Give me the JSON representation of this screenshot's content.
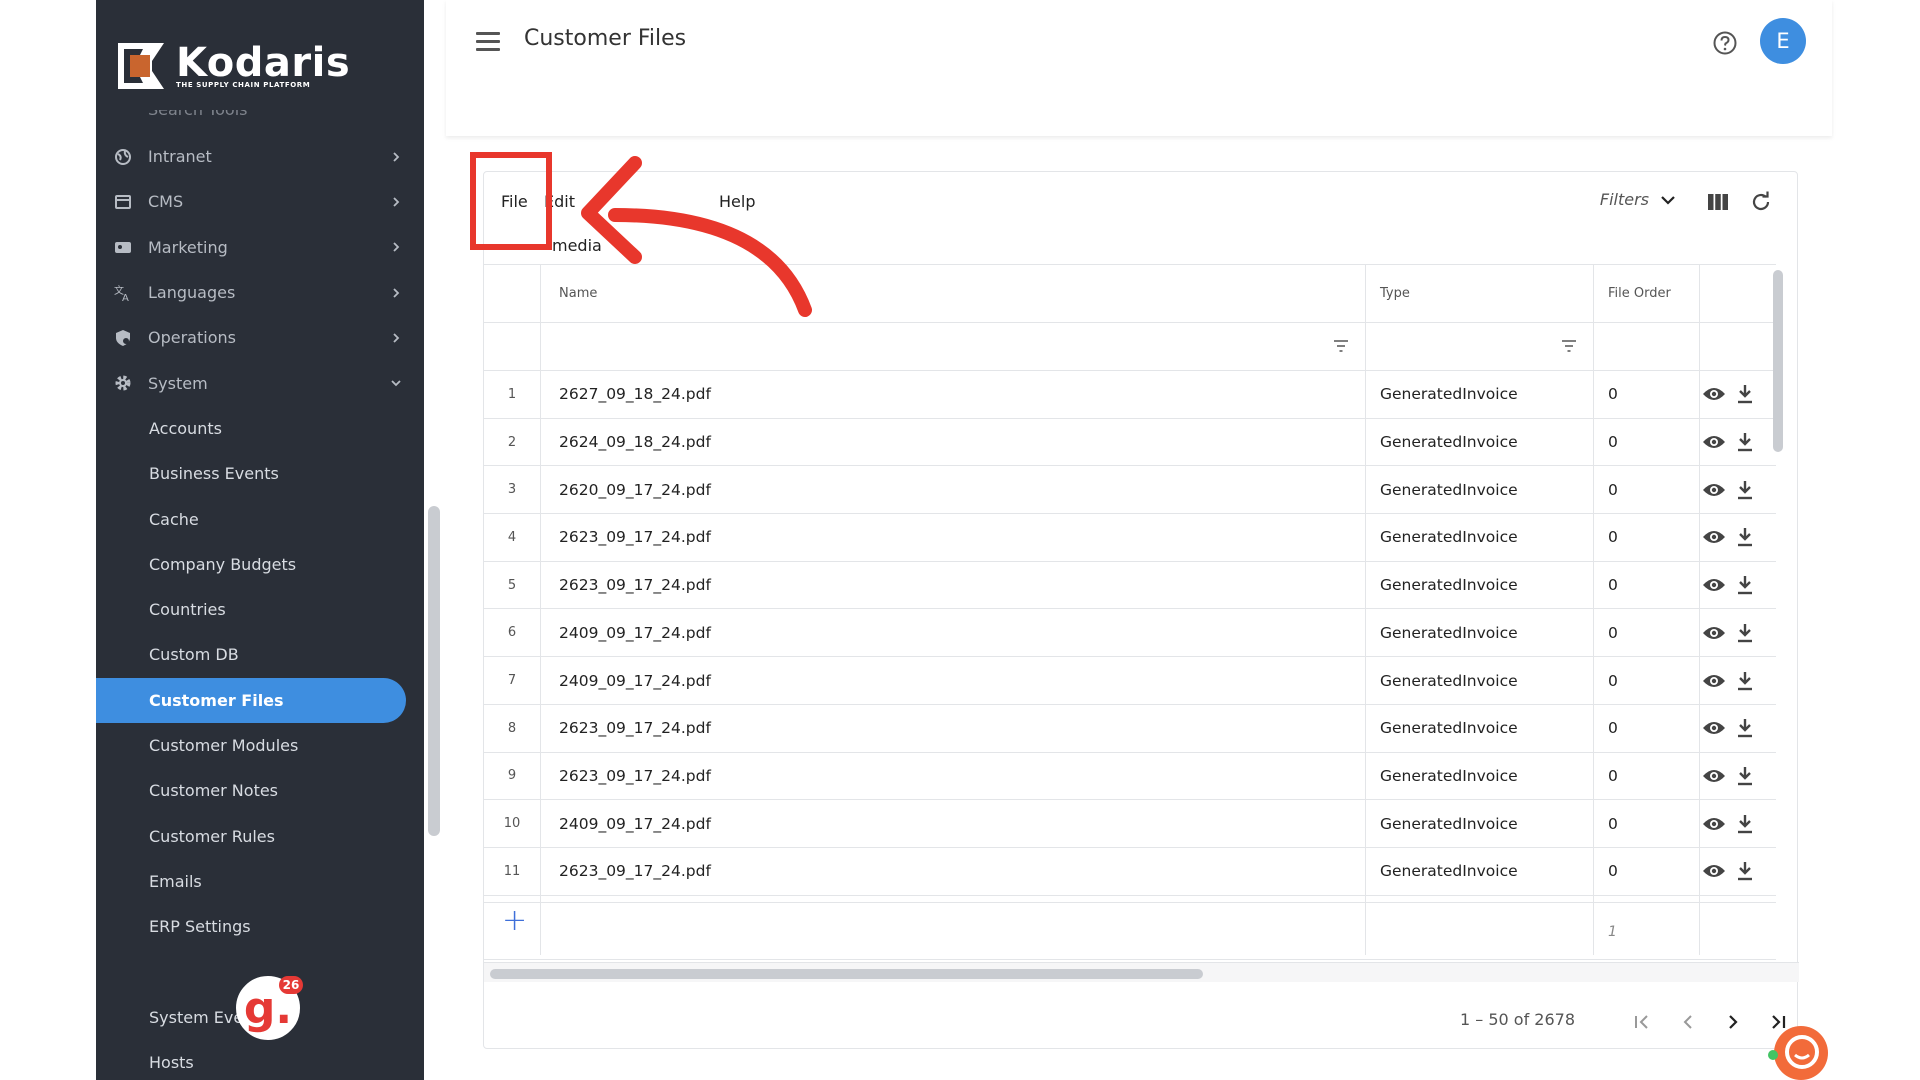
{
  "brand": {
    "name": "Kodaris",
    "tagline": "THE SUPPLY CHAIN PLATFORM"
  },
  "sidebar": {
    "partial_item": "Search Tools",
    "items": [
      {
        "label": "Intranet",
        "icon": "globe-icon"
      },
      {
        "label": "CMS",
        "icon": "cms-icon"
      },
      {
        "label": "Marketing",
        "icon": "marketing-icon"
      },
      {
        "label": "Languages",
        "icon": "translate-icon"
      },
      {
        "label": "Operations",
        "icon": "operations-icon"
      },
      {
        "label": "System",
        "icon": "gear-icon"
      }
    ],
    "system_items": [
      "Accounts",
      "Business Events",
      "Cache",
      "Company Budgets",
      "Countries",
      "Custom DB",
      "Customer Files",
      "Customer Modules",
      "Customer Notes",
      "Customer Rules",
      "Emails",
      "ERP Settings",
      "",
      "System Events",
      "Hosts"
    ],
    "active_item": "Customer Files",
    "badge_count": "26"
  },
  "header": {
    "title": "Customer Files",
    "avatar_letter": "E"
  },
  "toolbar": {
    "menu": [
      "File",
      "Edit",
      "",
      "Help"
    ],
    "filters_label": "Filters",
    "folder_path": "media"
  },
  "grid": {
    "columns": [
      "Name",
      "Type",
      "File Order"
    ],
    "rows": [
      {
        "num": "1",
        "name": "2627_09_18_24.pdf",
        "type": "GeneratedInvoice",
        "order": "0"
      },
      {
        "num": "2",
        "name": "2624_09_18_24.pdf",
        "type": "GeneratedInvoice",
        "order": "0"
      },
      {
        "num": "3",
        "name": "2620_09_17_24.pdf",
        "type": "GeneratedInvoice",
        "order": "0"
      },
      {
        "num": "4",
        "name": "2623_09_17_24.pdf",
        "type": "GeneratedInvoice",
        "order": "0"
      },
      {
        "num": "5",
        "name": "2623_09_17_24.pdf",
        "type": "GeneratedInvoice",
        "order": "0"
      },
      {
        "num": "6",
        "name": "2409_09_17_24.pdf",
        "type": "GeneratedInvoice",
        "order": "0"
      },
      {
        "num": "7",
        "name": "2409_09_17_24.pdf",
        "type": "GeneratedInvoice",
        "order": "0"
      },
      {
        "num": "8",
        "name": "2623_09_17_24.pdf",
        "type": "GeneratedInvoice",
        "order": "0"
      },
      {
        "num": "9",
        "name": "2623_09_17_24.pdf",
        "type": "GeneratedInvoice",
        "order": "0"
      },
      {
        "num": "10",
        "name": "2409_09_17_24.pdf",
        "type": "GeneratedInvoice",
        "order": "0"
      },
      {
        "num": "11",
        "name": "2623_09_17_24.pdf",
        "type": "GeneratedInvoice",
        "order": "0"
      }
    ],
    "summary_value": "1"
  },
  "pager": {
    "range_text": "1 – 50 of 2678"
  },
  "colors": {
    "accent": "#3e8ee0",
    "sidebar_bg": "#2a2f38",
    "annotation": "#e8372c",
    "logo_orange": "#c9652e"
  }
}
